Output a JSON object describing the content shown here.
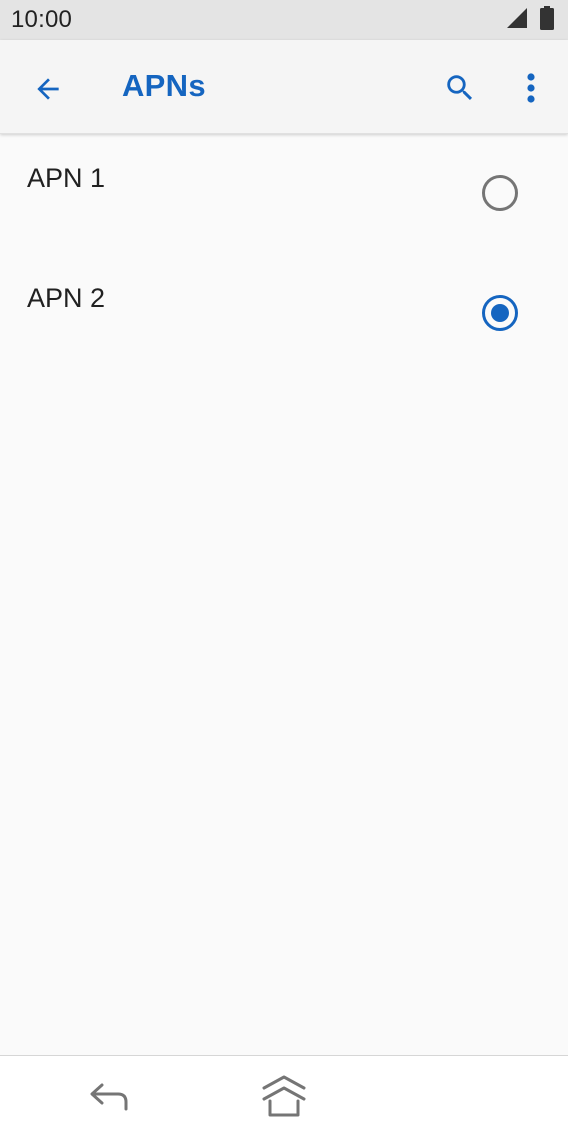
{
  "status_bar": {
    "time": "10:00",
    "icons": [
      "signal-icon",
      "battery-icon"
    ]
  },
  "app_bar": {
    "title": "APNs",
    "back_icon": "arrow-left-icon",
    "search_icon": "search-icon",
    "more_icon": "more-vert-icon"
  },
  "apn_list": [
    {
      "label": "APN 1",
      "selected": false
    },
    {
      "label": "APN 2",
      "selected": true
    }
  ],
  "nav_bar": {
    "back_icon": "nav-back-icon",
    "home_icon": "nav-home-icon"
  },
  "colors": {
    "accent": "#1565c0",
    "status_bar_bg": "#e4e4e4",
    "app_bar_bg": "#f5f5f5",
    "background": "#fafafa"
  }
}
